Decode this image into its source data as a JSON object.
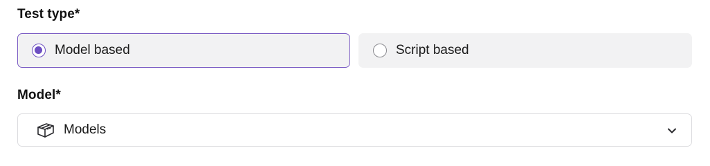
{
  "test_type": {
    "label": "Test type*",
    "options": [
      {
        "label": "Model based",
        "selected": true
      },
      {
        "label": "Script based",
        "selected": false
      }
    ]
  },
  "model": {
    "label": "Model*",
    "selected_value": "Models",
    "icon": "box-icon",
    "dropdown_icon": "chevron-down-icon"
  },
  "colors": {
    "accent": "#6d4fc2",
    "card_background": "#f2f2f3",
    "border": "#dcdcdf"
  }
}
